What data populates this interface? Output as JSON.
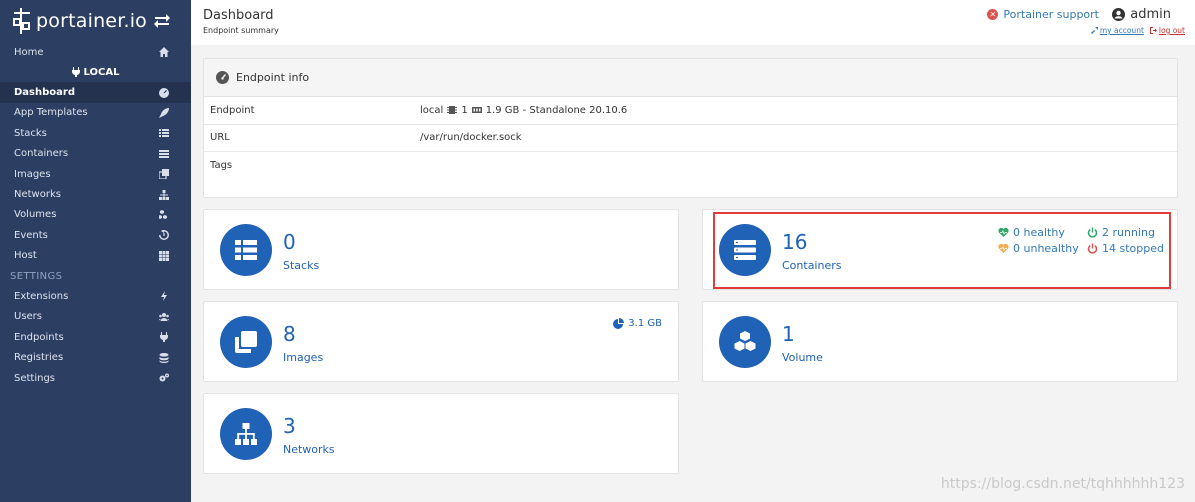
{
  "brand": {
    "name": "portainer.io"
  },
  "sidebar": {
    "items": [
      {
        "label": "Home",
        "icon": "home-icon"
      },
      {
        "label": "Dashboard",
        "icon": "dashboard-icon"
      },
      {
        "label": "App Templates",
        "icon": "rocket-icon"
      },
      {
        "label": "Stacks",
        "icon": "list-icon"
      },
      {
        "label": "Containers",
        "icon": "server-icon"
      },
      {
        "label": "Images",
        "icon": "clone-icon"
      },
      {
        "label": "Networks",
        "icon": "sitemap-icon"
      },
      {
        "label": "Volumes",
        "icon": "cubes-icon"
      },
      {
        "label": "Events",
        "icon": "history-icon"
      },
      {
        "label": "Host",
        "icon": "th-icon"
      }
    ],
    "endpoint_name": "LOCAL",
    "settings_section": "SETTINGS",
    "settings_items": [
      {
        "label": "Extensions",
        "icon": "bolt-icon"
      },
      {
        "label": "Users",
        "icon": "users-icon"
      },
      {
        "label": "Endpoints",
        "icon": "plug-icon"
      },
      {
        "label": "Registries",
        "icon": "database-icon"
      },
      {
        "label": "Settings",
        "icon": "cogs-icon"
      }
    ]
  },
  "header": {
    "title": "Dashboard",
    "subtitle": "Endpoint summary",
    "support": "Portainer support",
    "user": "admin",
    "my_account": "my account",
    "log_out": "log out"
  },
  "endpoint_info": {
    "title": "Endpoint info",
    "rows": [
      {
        "label": "Endpoint"
      },
      {
        "label": "URL",
        "value": "/var/run/docker.sock"
      },
      {
        "label": "Tags",
        "value": ""
      }
    ],
    "endpoint_name": "local",
    "cpu": "1",
    "memory": "1.9 GB - Standalone 20.10.6"
  },
  "widgets": {
    "stacks": {
      "count": "0",
      "label": "Stacks"
    },
    "containers": {
      "count": "16",
      "label": "Containers",
      "healthy": "0 healthy",
      "unhealthy": "0 unhealthy",
      "running": "2 running",
      "stopped": "14 stopped"
    },
    "images": {
      "count": "8",
      "label": "Images",
      "size": "3.1 GB"
    },
    "volumes": {
      "count": "1",
      "label": "Volume"
    },
    "networks": {
      "count": "3",
      "label": "Networks"
    }
  },
  "colors": {
    "sidebar": "#2d3e63",
    "accent": "#2062b6",
    "link": "#337ab7",
    "healthy": "#2fa86a",
    "unhealthy": "#f0ad4e",
    "running": "#2fa86a",
    "stopped": "#d9534f",
    "highlight": "#e23b3b"
  },
  "watermark": "https://blog.csdn.net/tqhhhhhh123"
}
